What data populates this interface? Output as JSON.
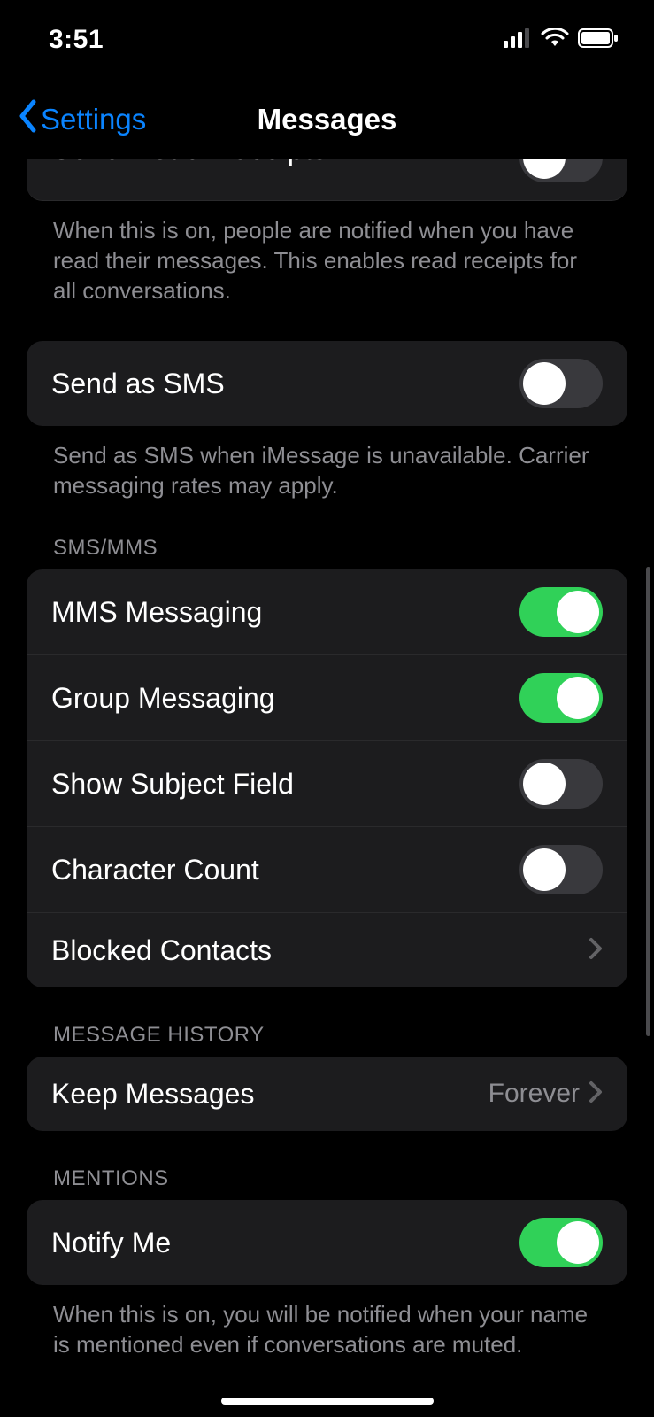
{
  "status": {
    "time": "3:51"
  },
  "nav": {
    "back_label": "Settings",
    "title": "Messages"
  },
  "read_receipts": {
    "label": "Send Read Receipts",
    "on": false,
    "footer": "When this is on, people are notified when you have read their messages. This enables read receipts for all conversations."
  },
  "send_as_sms": {
    "label": "Send as SMS",
    "on": false,
    "footer": "Send as SMS when iMessage is unavailable. Carrier messaging rates may apply."
  },
  "sms_mms_header": "SMS/MMS",
  "sms_mms": {
    "mms": {
      "label": "MMS Messaging",
      "on": true
    },
    "group": {
      "label": "Group Messaging",
      "on": true
    },
    "subj": {
      "label": "Show Subject Field",
      "on": false
    },
    "char": {
      "label": "Character Count",
      "on": false
    },
    "blocked_label": "Blocked Contacts"
  },
  "history_header": "MESSAGE HISTORY",
  "history": {
    "keep_label": "Keep Messages",
    "keep_value": "Forever"
  },
  "mentions_header": "MENTIONS",
  "mentions": {
    "notify_label": "Notify Me",
    "notify_on": true,
    "footer": "When this is on, you will be notified when your name is mentioned even if conversations are muted."
  }
}
